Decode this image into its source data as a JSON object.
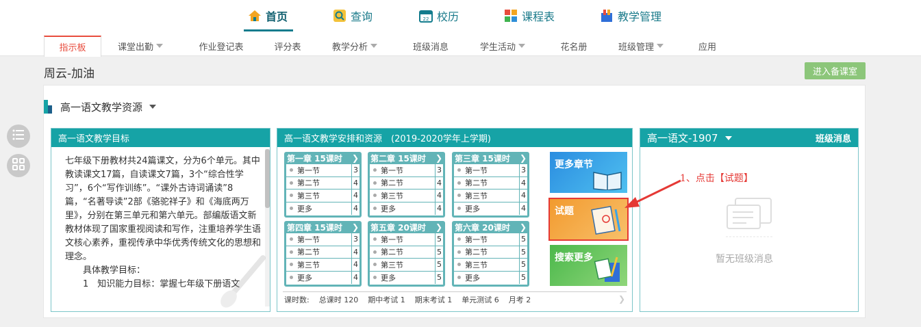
{
  "nav": {
    "items": [
      {
        "label": "首页",
        "icon": "home-icon"
      },
      {
        "label": "查询",
        "icon": "search-icon"
      },
      {
        "label": "校历",
        "icon": "calendar-icon"
      },
      {
        "label": "课程表",
        "icon": "timetable-icon"
      },
      {
        "label": "教学管理",
        "icon": "teaching-management-icon"
      }
    ],
    "active": "首页"
  },
  "tabs": [
    {
      "label": "指示板",
      "dropdown": false
    },
    {
      "label": "课堂出勤",
      "dropdown": true
    },
    {
      "label": "作业登记表",
      "dropdown": false
    },
    {
      "label": "评分表",
      "dropdown": false
    },
    {
      "label": "教学分析",
      "dropdown": true
    },
    {
      "label": "班级消息",
      "dropdown": false
    },
    {
      "label": "学生活动",
      "dropdown": true
    },
    {
      "label": "花名册",
      "dropdown": false
    },
    {
      "label": "班级管理",
      "dropdown": true
    },
    {
      "label": "应用",
      "dropdown": false
    }
  ],
  "greeting": "周云-加油",
  "enter_button": "进入备课室",
  "resource_title": "高一语文教学资源",
  "goals": {
    "title": "高一语文教学目标",
    "paragraphs": [
      "七年级下册教材共24篇课文，分为6个单元。其中教读课文17篇，自读课文7篇，3个“综合性学习”，6个“写作训练”。“课外古诗词诵读”8篇，“名著导读”2部《骆驼祥子》和《海底两万里》，分别在第三单元和第六单元。部编版语文新教材体现了国家重视阅读和写作，注重培养学生语文核心素养，重视传承中华优秀传统文化的思想和理念。",
      "　　具体教学目标：",
      "　　1　知识能力目标：掌握七年级下册语文"
    ]
  },
  "schedule": {
    "title": "高一语文教学安排和资源　(2019-2020学年上学期)",
    "chapters": [
      {
        "title": "第一章 15课时",
        "rows": [
          {
            "label": "第一节",
            "count": "3"
          },
          {
            "label": "第二节",
            "count": "4"
          },
          {
            "label": "第三节",
            "count": "4"
          },
          {
            "label": "更多",
            "count": "4"
          }
        ]
      },
      {
        "title": "第二章 15课时",
        "rows": [
          {
            "label": "第一节",
            "count": "3"
          },
          {
            "label": "第二节",
            "count": "4"
          },
          {
            "label": "第三节",
            "count": "4"
          },
          {
            "label": "更多",
            "count": "4"
          }
        ]
      },
      {
        "title": "第三章 15课时",
        "rows": [
          {
            "label": "第一节",
            "count": "3"
          },
          {
            "label": "第二节",
            "count": "4"
          },
          {
            "label": "第三节",
            "count": "4"
          },
          {
            "label": "更多",
            "count": "4"
          }
        ]
      },
      {
        "title": "第四章 15课时",
        "rows": [
          {
            "label": "第一节",
            "count": "3"
          },
          {
            "label": "第二节",
            "count": "4"
          },
          {
            "label": "第三节",
            "count": "4"
          },
          {
            "label": "更多",
            "count": "4"
          }
        ]
      },
      {
        "title": "第五章 20课时",
        "rows": [
          {
            "label": "第一节",
            "count": "5"
          },
          {
            "label": "第二节",
            "count": "5"
          },
          {
            "label": "第三节",
            "count": "5"
          },
          {
            "label": "更多",
            "count": "5"
          }
        ]
      },
      {
        "title": "第六章 20课时",
        "rows": [
          {
            "label": "第一节",
            "count": "5"
          },
          {
            "label": "第二节",
            "count": "5"
          },
          {
            "label": "第三节",
            "count": "5"
          },
          {
            "label": "更多",
            "count": "5"
          }
        ]
      }
    ],
    "tiles": [
      {
        "label": "更多章节",
        "color": "#3aa4e8"
      },
      {
        "label": "试题",
        "color": "#f5a742"
      },
      {
        "label": "搜索更多",
        "color": "#5fbd5f"
      }
    ],
    "stats": [
      "课时数:",
      "总课时 120",
      "期中考试 1",
      "期末考试 1",
      "单元测试 6",
      "月考 2"
    ]
  },
  "class_panel": {
    "title": "高一语文-1907",
    "link": "班级消息",
    "empty": "暂无班级消息"
  },
  "annotation": "1、点击【试题】",
  "colors": {
    "teal": "#16a3a6",
    "chapter": "#62b4b7",
    "accent_red": "#e53935",
    "green_button": "#8cc67a"
  }
}
